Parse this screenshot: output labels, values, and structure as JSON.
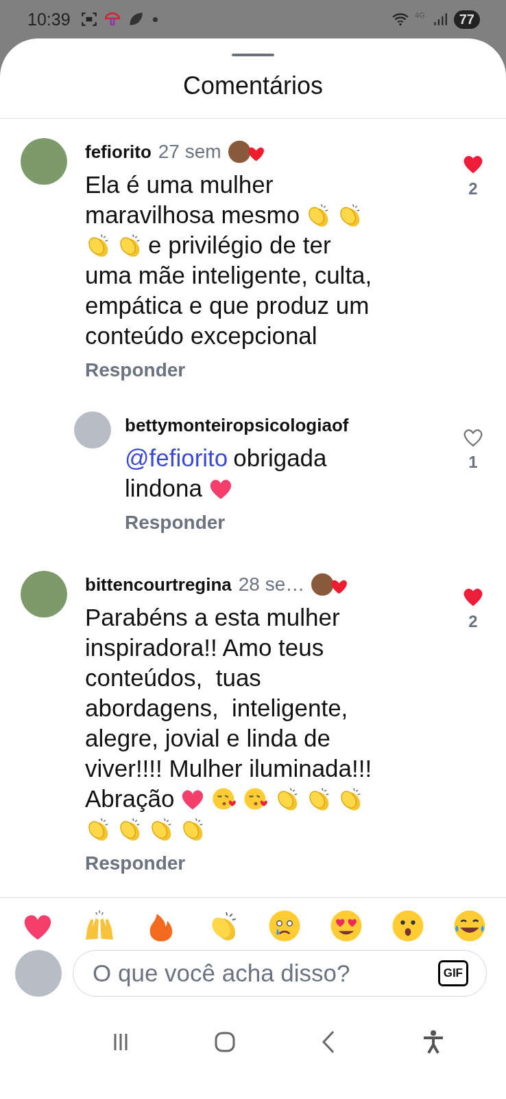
{
  "status_bar": {
    "time": "10:39",
    "network": "4G",
    "battery": "77"
  },
  "sheet": {
    "title": "Comentários"
  },
  "comments": [
    {
      "username": "fefiorito",
      "time": "27 sem",
      "creator_liked": true,
      "liked": true,
      "likes": "2",
      "reply_label": "Responder",
      "is_reply": false,
      "lines": [
        [
          {
            "kind": "text",
            "text": "Ela é uma mulher"
          }
        ],
        [
          {
            "kind": "text",
            "text": "maravilhosa mesmo"
          },
          {
            "kind": "clap"
          },
          {
            "kind": "clap"
          }
        ],
        [
          {
            "kind": "clap"
          },
          {
            "kind": "clap"
          },
          {
            "kind": "text",
            "text": "e privilégio de ter"
          }
        ],
        [
          {
            "kind": "text",
            "text": "uma mãe inteligente, culta,"
          }
        ],
        [
          {
            "kind": "text",
            "text": "empática e que produz um"
          }
        ],
        [
          {
            "kind": "text",
            "text": "conteúdo excepcional"
          }
        ]
      ]
    },
    {
      "username": "bettymonteiropsicologiaof",
      "creator_liked": false,
      "liked": false,
      "likes": "1",
      "reply_label": "Responder",
      "is_reply": true,
      "lines": [
        [
          {
            "kind": "mention",
            "text": "@fefiorito"
          },
          {
            "kind": "text",
            "text": "obrigada"
          }
        ],
        [
          {
            "kind": "text",
            "text": "lindona"
          },
          {
            "kind": "heart"
          }
        ]
      ]
    },
    {
      "username": "bittencourtregina",
      "time": "28 se…",
      "creator_liked": true,
      "liked": true,
      "likes": "2",
      "reply_label": "Responder",
      "is_reply": false,
      "lines": [
        [
          {
            "kind": "text",
            "text": "Parabéns a esta mulher"
          }
        ],
        [
          {
            "kind": "text",
            "text": "inspiradora!! Amo teus"
          }
        ],
        [
          {
            "kind": "text",
            "text": "conteúdos,  tuas"
          }
        ],
        [
          {
            "kind": "text",
            "text": "abordagens,  inteligente,"
          }
        ],
        [
          {
            "kind": "text",
            "text": "alegre, jovial e linda de"
          }
        ],
        [
          {
            "kind": "text",
            "text": "viver!!!! Mulher iluminada!!!"
          }
        ],
        [
          {
            "kind": "text",
            "text": "Abração"
          },
          {
            "kind": "heart"
          },
          {
            "kind": "kiss"
          },
          {
            "kind": "kiss"
          },
          {
            "kind": "clap"
          },
          {
            "kind": "clap"
          },
          {
            "kind": "clap"
          }
        ],
        [
          {
            "kind": "clap"
          },
          {
            "kind": "clap"
          },
          {
            "kind": "clap"
          },
          {
            "kind": "clap"
          }
        ]
      ]
    }
  ],
  "composer": {
    "placeholder": "O que você acha disso?",
    "gif_label": "GIF"
  }
}
